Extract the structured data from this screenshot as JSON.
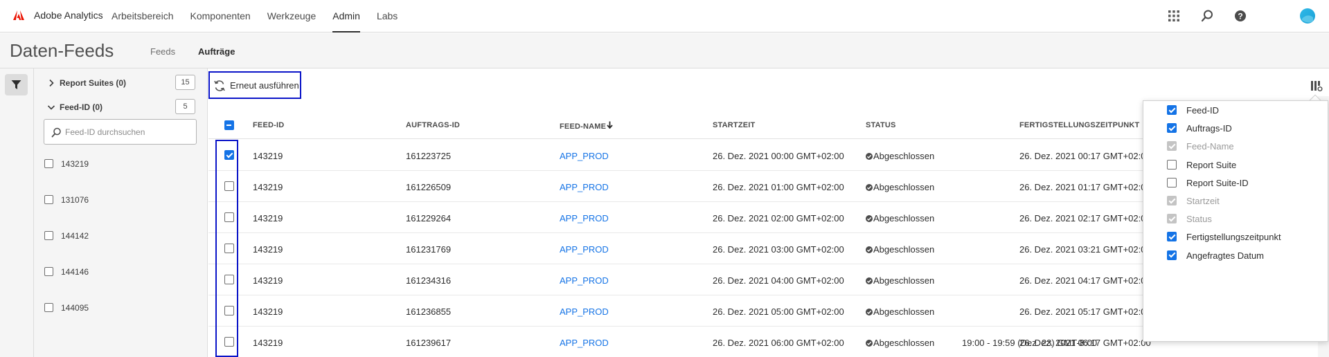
{
  "app": {
    "name": "Adobe Analytics"
  },
  "nav": [
    "Arbeitsbereich",
    "Komponenten",
    "Werkzeuge",
    "Admin",
    "Labs"
  ],
  "nav_active": "Admin",
  "page": {
    "title": "Daten-Feeds",
    "tabs": [
      "Feeds",
      "Aufträge"
    ],
    "active_tab": "Aufträge"
  },
  "filters": {
    "groups": [
      {
        "label": "Report Suites (0)",
        "count": "15",
        "expanded": false
      },
      {
        "label": "Feed-ID (0)",
        "count": "5",
        "expanded": true
      }
    ],
    "search_placeholder": "Feed-ID durchsuchen",
    "items": [
      "143219",
      "131076",
      "144142",
      "144146",
      "144095"
    ]
  },
  "toolbar": {
    "rerun_label": "Erneut ausführen"
  },
  "table": {
    "columns": [
      "FEED-ID",
      "AUFTRAGS-ID",
      "FEED-NAME",
      "STARTZEIT",
      "STATUS",
      "FERTIGSTELLUNGSZEITPUNKT"
    ],
    "sorted_column": "FEED-NAME",
    "rows": [
      {
        "checked": true,
        "feed_id": "143219",
        "job_id": "161223725",
        "feed_name": "APP_PROD",
        "start": "26. Dez. 2021 00:00 GMT+02:00",
        "status": "Abgeschlossen",
        "completed": "26. Dez. 2021 00:17 GMT+02:00"
      },
      {
        "checked": false,
        "feed_id": "143219",
        "job_id": "161226509",
        "feed_name": "APP_PROD",
        "start": "26. Dez. 2021 01:00 GMT+02:00",
        "status": "Abgeschlossen",
        "completed": "26. Dez. 2021 01:17 GMT+02:00"
      },
      {
        "checked": false,
        "feed_id": "143219",
        "job_id": "161229264",
        "feed_name": "APP_PROD",
        "start": "26. Dez. 2021 02:00 GMT+02:00",
        "status": "Abgeschlossen",
        "completed": "26. Dez. 2021 02:17 GMT+02:00"
      },
      {
        "checked": false,
        "feed_id": "143219",
        "job_id": "161231769",
        "feed_name": "APP_PROD",
        "start": "26. Dez. 2021 03:00 GMT+02:00",
        "status": "Abgeschlossen",
        "completed": "26. Dez. 2021 03:21 GMT+02:00"
      },
      {
        "checked": false,
        "feed_id": "143219",
        "job_id": "161234316",
        "feed_name": "APP_PROD",
        "start": "26. Dez. 2021 04:00 GMT+02:00",
        "status": "Abgeschlossen",
        "completed": "26. Dez. 2021 04:17 GMT+02:00"
      },
      {
        "checked": false,
        "feed_id": "143219",
        "job_id": "161236855",
        "feed_name": "APP_PROD",
        "start": "26. Dez. 2021 05:00 GMT+02:00",
        "status": "Abgeschlossen",
        "completed": "26. Dez. 2021 05:17 GMT+02:00"
      },
      {
        "checked": false,
        "feed_id": "143219",
        "job_id": "161239617",
        "feed_name": "APP_PROD",
        "start": "26. Dez. 2021 06:00 GMT+02:00",
        "status": "Abgeschlossen",
        "completed": "26. Dez. 2021 06:17 GMT+02:00"
      }
    ],
    "hidden_column_peek": "19:00 - 19:59 (Dez. 23) GMT-8:00"
  },
  "column_settings": [
    {
      "label": "Feed-ID",
      "checked": true,
      "disabled": false
    },
    {
      "label": "Auftrags-ID",
      "checked": true,
      "disabled": false
    },
    {
      "label": "Feed-Name",
      "checked": true,
      "disabled": true
    },
    {
      "label": "Report Suite",
      "checked": false,
      "disabled": false
    },
    {
      "label": "Report Suite-ID",
      "checked": false,
      "disabled": false
    },
    {
      "label": "Startzeit",
      "checked": true,
      "disabled": true
    },
    {
      "label": "Status",
      "checked": true,
      "disabled": true
    },
    {
      "label": "Fertigstellungszeitpunkt",
      "checked": true,
      "disabled": false
    },
    {
      "label": "Angefragtes Datum",
      "checked": true,
      "disabled": false
    }
  ],
  "colors": {
    "accent": "#1473e6",
    "brand": "#eb1000",
    "highlight": "#0a14c8"
  }
}
